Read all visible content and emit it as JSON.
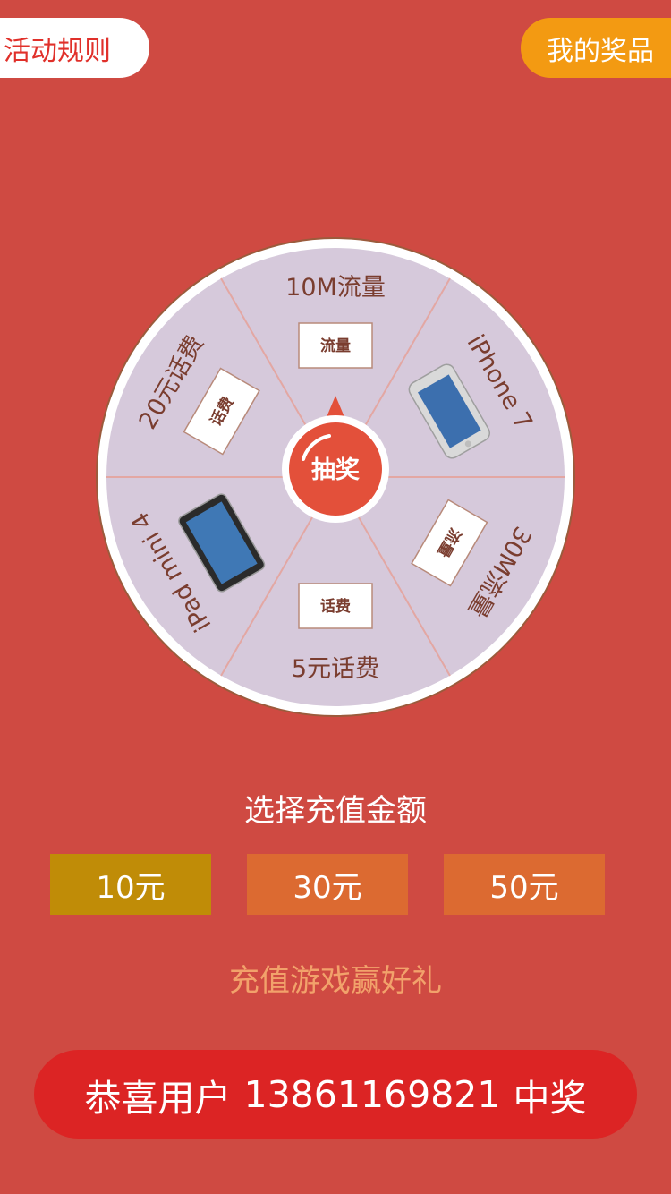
{
  "header": {
    "rules_label": "活动规则",
    "prizes_label": "我的奖品"
  },
  "wheel": {
    "segments": [
      {
        "label": "10M流量",
        "icon": "data-ticket-icon",
        "ticket_text": "流量"
      },
      {
        "label": "iPhone 7",
        "icon": "iphone-image"
      },
      {
        "label": "30M流量",
        "icon": "data-ticket-icon",
        "ticket_text": "流量"
      },
      {
        "label": "5元话费",
        "icon": "phone-credit-ticket-icon",
        "ticket_text": "话费"
      },
      {
        "label": "iPad mini 4",
        "icon": "ipad-image"
      },
      {
        "label": "20元话费",
        "icon": "phone-credit-ticket-icon",
        "ticket_text": "话费"
      }
    ],
    "draw_label": "抽奖",
    "colors": {
      "segment": "#d6c9db",
      "rim": "#ffffff",
      "divider": "#e3a7a3",
      "draw_button": "#e3503a"
    }
  },
  "recharge": {
    "title": "选择充值金额",
    "options": [
      "10元",
      "30元",
      "50元"
    ],
    "selected": "10元"
  },
  "slogan": "充值游戏赢好礼",
  "winner": {
    "prefix": "恭喜用户",
    "phone": "13861169821",
    "suffix": "中奖"
  },
  "colors": {
    "background": "#cf4a42",
    "selected_amount": "#c08c07",
    "amount": "#dc6a31",
    "winner_bar": "#dc2424",
    "prizes_button": "#f39a12"
  }
}
